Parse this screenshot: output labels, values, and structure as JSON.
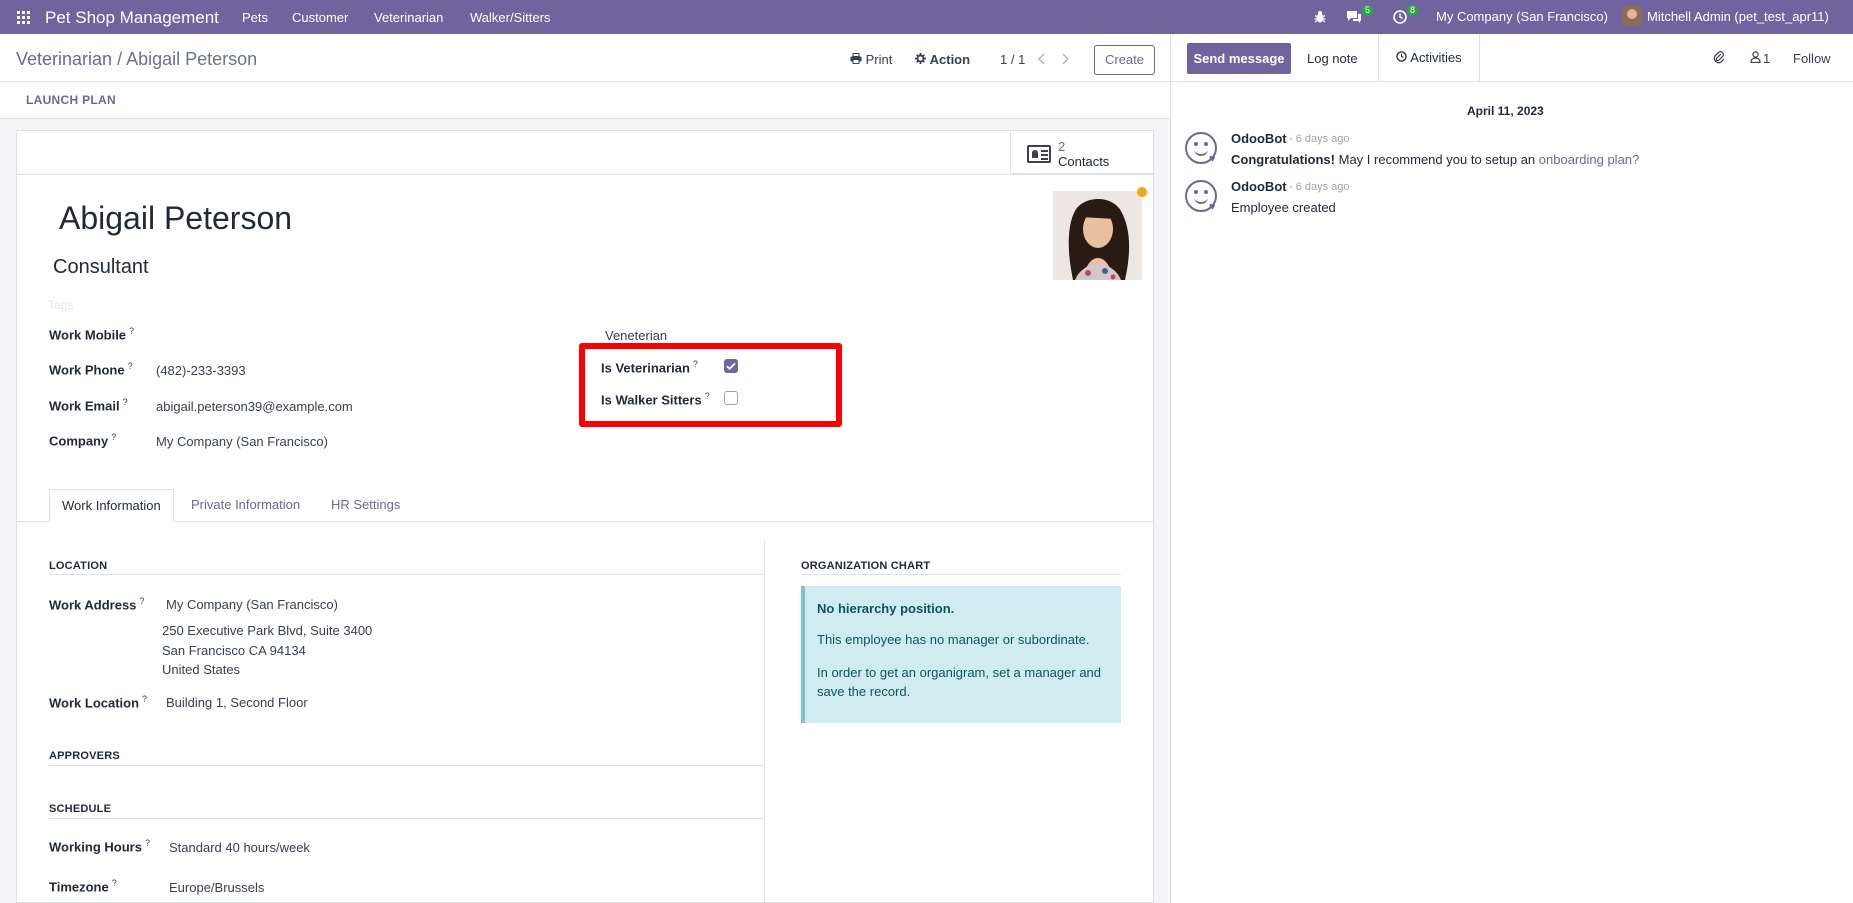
{
  "topbar": {
    "app_title": "Pet Shop Management",
    "menu": [
      "Pets",
      "Customer",
      "Veterinarian",
      "Walker/Sitters"
    ],
    "messages_count": "5",
    "activities_count": "8",
    "company": "My Company (San Francisco)",
    "user": "Mitchell Admin (pet_test_apr11)"
  },
  "breadcrumb": {
    "parent": "Veterinarian",
    "separator": " / ",
    "current": "Abigail Peterson"
  },
  "toolbar": {
    "print": "Print",
    "action": "Action",
    "pager": "1 / 1",
    "create": "Create"
  },
  "statusbar": {
    "launch_plan": "LAUNCH PLAN"
  },
  "smart_button": {
    "count": "2",
    "label": "Contacts"
  },
  "employee": {
    "name": "Abigail Peterson",
    "job_title": "Consultant",
    "tags_placeholder": "Tags",
    "fields": {
      "work_mobile": {
        "label": "Work Mobile",
        "value": ""
      },
      "work_phone": {
        "label": "Work Phone",
        "value": "(482)-233-3393"
      },
      "work_email": {
        "label": "Work Email",
        "value": "abigail.peterson39@example.com"
      },
      "company": {
        "label": "Company",
        "value": "My Company (San Francisco)"
      }
    },
    "right_group": {
      "title": "Veneterian",
      "is_veterinarian": {
        "label": "Is Veterinarian",
        "checked": true
      },
      "is_walker_sitters": {
        "label": "Is Walker Sitters",
        "checked": false
      }
    },
    "tooltip_mark": "?"
  },
  "tabs": [
    "Work Information",
    "Private Information",
    "HR Settings"
  ],
  "work_info": {
    "location_title": "LOCATION",
    "work_address_label": "Work Address",
    "work_address_name": "My Company (San Francisco)",
    "address_line1": "250 Executive Park Blvd, Suite 3400",
    "address_line2": "San Francisco CA 94134",
    "address_line3": "United States",
    "work_location_label": "Work Location",
    "work_location": "Building 1, Second Floor",
    "approvers_title": "APPROVERS",
    "schedule_title": "SCHEDULE",
    "working_hours_label": "Working Hours",
    "working_hours": "Standard 40 hours/week",
    "timezone_label": "Timezone",
    "timezone": "Europe/Brussels"
  },
  "org_chart": {
    "title": "ORGANIZATION CHART",
    "heading": "No hierarchy position.",
    "line1": "This employee has no manager or subordinate.",
    "line2": "In order to get an organigram, set a manager and save the record."
  },
  "chatter": {
    "send_message": "Send message",
    "log_note": "Log note",
    "activities": "Activities",
    "followers_count": "1",
    "follow": "Follow",
    "date": "April 11, 2023",
    "messages": [
      {
        "author": "OdooBot",
        "ago": "- 6 days ago",
        "bold": "Congratulations!",
        "text": " May I recommend you to setup an ",
        "link": "onboarding plan?"
      },
      {
        "author": "OdooBot",
        "ago": "- 6 days ago",
        "text": "Employee created"
      }
    ]
  },
  "colors": {
    "brand": "#71639e",
    "highlight": "#ff0000",
    "info_bg": "#d1ecf1"
  }
}
